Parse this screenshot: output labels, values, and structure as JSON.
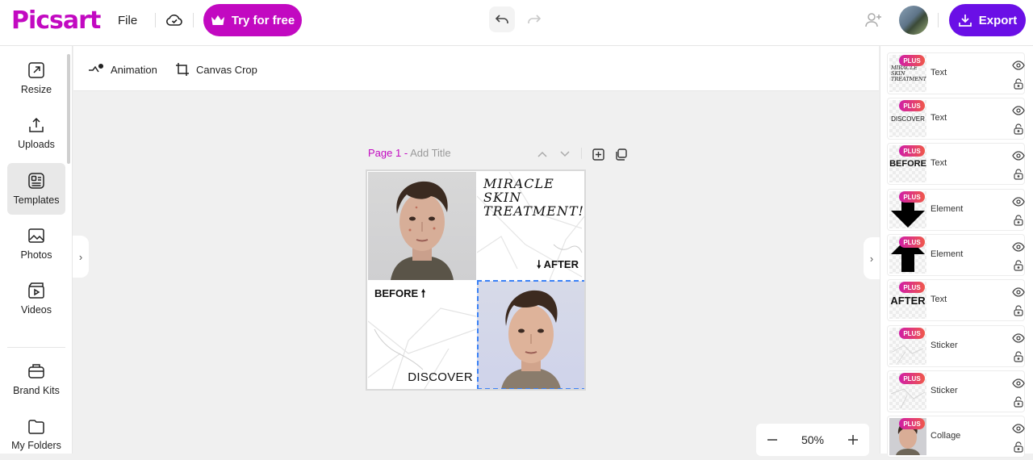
{
  "app": {
    "logo": "Picsart",
    "brand_color": "#c209c1",
    "accent_color": "#6a0fe6"
  },
  "topbar": {
    "file_label": "File",
    "try_label": "Try for free",
    "export_label": "Export",
    "icons": [
      "cloud-check-icon",
      "crown-icon",
      "undo-icon",
      "redo-icon",
      "add-user-icon",
      "download-icon"
    ]
  },
  "sidebar": {
    "items": [
      {
        "label": "Resize",
        "icon": "resize-icon"
      },
      {
        "label": "Uploads",
        "icon": "upload-icon"
      },
      {
        "label": "Templates",
        "icon": "templates-icon",
        "active": true
      },
      {
        "label": "Photos",
        "icon": "photo-icon"
      },
      {
        "label": "Videos",
        "icon": "video-icon"
      },
      {
        "label": "Brand Kits",
        "icon": "brand-kit-icon"
      },
      {
        "label": "My Folders",
        "icon": "folder-icon"
      }
    ]
  },
  "toolbar": {
    "animation_label": "Animation",
    "crop_label": "Canvas Crop"
  },
  "page": {
    "page_label": "Page 1 -",
    "title_placeholder": "Add Title"
  },
  "canvas": {
    "miracle_text": "MIRACLE\nSKIN\nTREATMENT!",
    "after_text": "🠗 AFTER",
    "before_text": "BEFORE 🠕",
    "discover_text": "DISCOVER"
  },
  "zoom": {
    "value": "50%"
  },
  "layers": {
    "plus_badge": "PLUS",
    "items": [
      {
        "name": "Text",
        "thumb": "miracle"
      },
      {
        "name": "Text",
        "thumb": "DISCOVER"
      },
      {
        "name": "Text",
        "thumb": "BEFORE"
      },
      {
        "name": "Element",
        "thumb": "arrow-down"
      },
      {
        "name": "Element",
        "thumb": "arrow-up"
      },
      {
        "name": "Text",
        "thumb": "AFTER"
      },
      {
        "name": "Sticker",
        "thumb": "marble"
      },
      {
        "name": "Sticker",
        "thumb": "marble"
      },
      {
        "name": "Collage",
        "thumb": "face"
      }
    ]
  }
}
